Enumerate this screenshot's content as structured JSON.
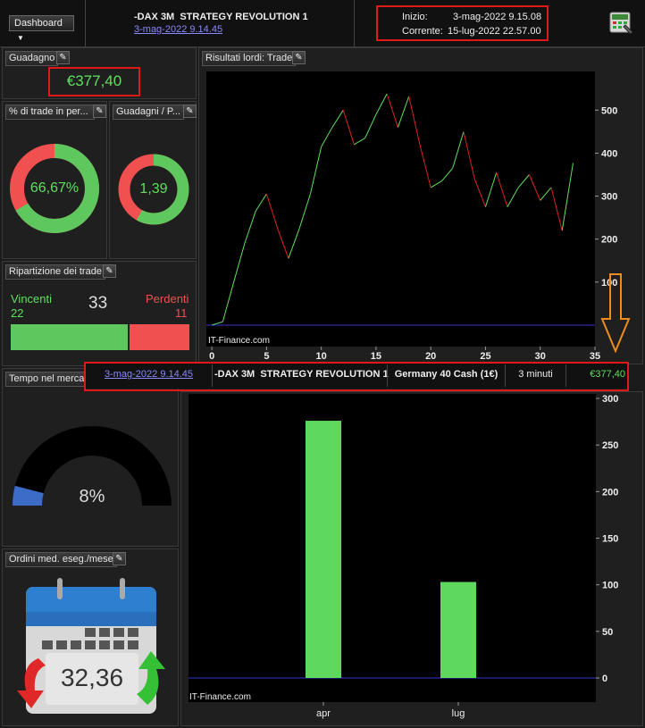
{
  "header": {
    "dashboard_label": "Dashboard",
    "strategy_name": "-DAX 3M  STRATEGY REVOLUTION 1",
    "strategy_date": "3-mag-2022 9.14.45",
    "start_label": "Inizio:",
    "start_value": "3-mag-2022 9.15.08",
    "current_label": "Corrente:",
    "current_value": "15-lug-2022 22.57.00"
  },
  "guadagno": {
    "title": "Guadagno",
    "value": "€377,40"
  },
  "win_pct": {
    "title": "% di trade in per...",
    "value": "66,67%",
    "fraction": 0.6667
  },
  "ratio": {
    "title": "Guadagni / P...",
    "value": "1,39",
    "fraction": 0.58
  },
  "ripartizione": {
    "title": "Ripartizione dei trade",
    "winners_label": "Vincenti",
    "winners": "22",
    "total": "33",
    "losers_label": "Perdenti",
    "losers": "11",
    "winners_fraction": 0.6667
  },
  "tempo": {
    "title": "Tempo nel mercato",
    "value": "8%",
    "fraction": 0.08
  },
  "ordini": {
    "title": "Ordini med. eseg./mese",
    "value": "32,36"
  },
  "results_title": "Risultati lordi: Trade",
  "watermark": "IT-Finance.com",
  "row": {
    "date": "3-mag-2022 9.14.45",
    "strategy": "-DAX 3M  STRATEGY REVOLUTION 1",
    "instrument": "Germany 40 Cash (1€)",
    "timeframe": "3 minuti",
    "gain": "€377,40"
  },
  "colors": {
    "up": "#5ee05e",
    "down": "#e02020",
    "accent_red": "#e01818",
    "arrow": "#f08c1e"
  },
  "chart_data": [
    {
      "type": "line",
      "xlabel": "",
      "ylabel": "",
      "x_ticks": [
        "0",
        "5",
        "10",
        "15",
        "20",
        "25",
        "30",
        "35"
      ],
      "y_ticks": [
        "100",
        "200",
        "300",
        "400",
        "500"
      ],
      "xlim": [
        -0.5,
        35
      ],
      "ylim": [
        -50,
        590
      ],
      "x": [
        0,
        1,
        2,
        3,
        4,
        5,
        6,
        7,
        8,
        9,
        10,
        11,
        12,
        13,
        14,
        15,
        16,
        17,
        18,
        19,
        20,
        21,
        22,
        23,
        24,
        25,
        26,
        27,
        28,
        29,
        30,
        31,
        32,
        33
      ],
      "values": [
        0,
        8,
        100,
        190,
        265,
        305,
        225,
        155,
        225,
        305,
        415,
        460,
        500,
        420,
        435,
        490,
        538,
        460,
        532,
        420,
        320,
        335,
        365,
        450,
        340,
        275,
        355,
        275,
        320,
        350,
        290,
        320,
        220,
        377
      ]
    },
    {
      "type": "bar",
      "categories": [
        "apr",
        "lug"
      ],
      "values": [
        276,
        103
      ],
      "y_ticks": [
        "0",
        "50",
        "100",
        "150",
        "200",
        "250",
        "300"
      ],
      "ylim": [
        0,
        300
      ]
    }
  ]
}
